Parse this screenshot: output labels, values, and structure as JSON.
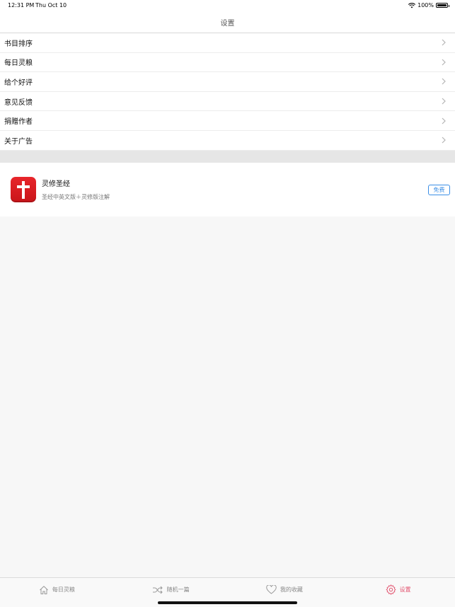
{
  "status_bar": {
    "time": "12:31 PM",
    "date": "Thu Oct 10",
    "battery": "100%"
  },
  "nav": {
    "title": "设置"
  },
  "menu": {
    "items": [
      {
        "label": "书目排序"
      },
      {
        "label": "每日灵粮"
      },
      {
        "label": "给个好评"
      },
      {
        "label": "意见反馈"
      },
      {
        "label": "捐赠作者"
      },
      {
        "label": "关于广告"
      }
    ]
  },
  "ad": {
    "title": "灵修圣经",
    "subtitle": "圣经中英文版＋灵修版注解",
    "button": "免费",
    "icon": "cross-app-icon",
    "icon_color": "#d81e24"
  },
  "tabs": [
    {
      "label": "每日灵粮",
      "icon": "home-icon",
      "active": false
    },
    {
      "label": "随机一篇",
      "icon": "shuffle-icon",
      "active": false
    },
    {
      "label": "我的收藏",
      "icon": "heart-icon",
      "active": false
    },
    {
      "label": "设置",
      "icon": "gear-icon",
      "active": true
    }
  ],
  "colors": {
    "accent": "#e2516d",
    "link": "#3a8ee6"
  }
}
